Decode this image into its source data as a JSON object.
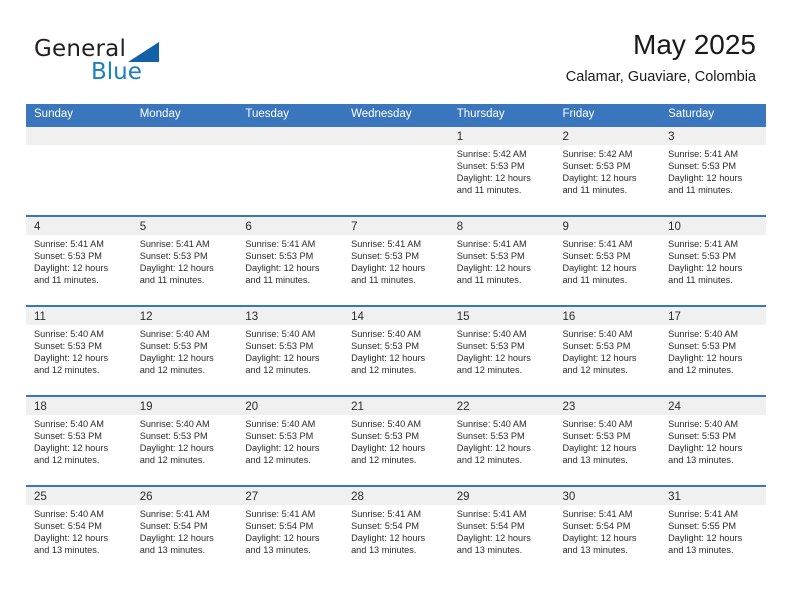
{
  "brand": {
    "name_part1": "General",
    "name_part2": "Blue",
    "triangle_color": "#1260a8",
    "blue_text_color": "#1a7fc1"
  },
  "header": {
    "title": "May 2025",
    "subtitle": "Calamar, Guaviare, Colombia"
  },
  "theme": {
    "header_bar_color": "#3a76bd",
    "day_band_color": "#f0f0f0",
    "text_color": "#2b2b2b"
  },
  "weekdays": [
    "Sunday",
    "Monday",
    "Tuesday",
    "Wednesday",
    "Thursday",
    "Friday",
    "Saturday"
  ],
  "weeks": [
    [
      {
        "day": "",
        "empty": true
      },
      {
        "day": "",
        "empty": true
      },
      {
        "day": "",
        "empty": true
      },
      {
        "day": "",
        "empty": true
      },
      {
        "day": "1",
        "sunrise": "Sunrise: 5:42 AM",
        "sunset": "Sunset: 5:53 PM",
        "daylight1": "Daylight: 12 hours",
        "daylight2": "and 11 minutes."
      },
      {
        "day": "2",
        "sunrise": "Sunrise: 5:42 AM",
        "sunset": "Sunset: 5:53 PM",
        "daylight1": "Daylight: 12 hours",
        "daylight2": "and 11 minutes."
      },
      {
        "day": "3",
        "sunrise": "Sunrise: 5:41 AM",
        "sunset": "Sunset: 5:53 PM",
        "daylight1": "Daylight: 12 hours",
        "daylight2": "and 11 minutes."
      }
    ],
    [
      {
        "day": "4",
        "sunrise": "Sunrise: 5:41 AM",
        "sunset": "Sunset: 5:53 PM",
        "daylight1": "Daylight: 12 hours",
        "daylight2": "and 11 minutes."
      },
      {
        "day": "5",
        "sunrise": "Sunrise: 5:41 AM",
        "sunset": "Sunset: 5:53 PM",
        "daylight1": "Daylight: 12 hours",
        "daylight2": "and 11 minutes."
      },
      {
        "day": "6",
        "sunrise": "Sunrise: 5:41 AM",
        "sunset": "Sunset: 5:53 PM",
        "daylight1": "Daylight: 12 hours",
        "daylight2": "and 11 minutes."
      },
      {
        "day": "7",
        "sunrise": "Sunrise: 5:41 AM",
        "sunset": "Sunset: 5:53 PM",
        "daylight1": "Daylight: 12 hours",
        "daylight2": "and 11 minutes."
      },
      {
        "day": "8",
        "sunrise": "Sunrise: 5:41 AM",
        "sunset": "Sunset: 5:53 PM",
        "daylight1": "Daylight: 12 hours",
        "daylight2": "and 11 minutes."
      },
      {
        "day": "9",
        "sunrise": "Sunrise: 5:41 AM",
        "sunset": "Sunset: 5:53 PM",
        "daylight1": "Daylight: 12 hours",
        "daylight2": "and 11 minutes."
      },
      {
        "day": "10",
        "sunrise": "Sunrise: 5:41 AM",
        "sunset": "Sunset: 5:53 PM",
        "daylight1": "Daylight: 12 hours",
        "daylight2": "and 11 minutes."
      }
    ],
    [
      {
        "day": "11",
        "sunrise": "Sunrise: 5:40 AM",
        "sunset": "Sunset: 5:53 PM",
        "daylight1": "Daylight: 12 hours",
        "daylight2": "and 12 minutes."
      },
      {
        "day": "12",
        "sunrise": "Sunrise: 5:40 AM",
        "sunset": "Sunset: 5:53 PM",
        "daylight1": "Daylight: 12 hours",
        "daylight2": "and 12 minutes."
      },
      {
        "day": "13",
        "sunrise": "Sunrise: 5:40 AM",
        "sunset": "Sunset: 5:53 PM",
        "daylight1": "Daylight: 12 hours",
        "daylight2": "and 12 minutes."
      },
      {
        "day": "14",
        "sunrise": "Sunrise: 5:40 AM",
        "sunset": "Sunset: 5:53 PM",
        "daylight1": "Daylight: 12 hours",
        "daylight2": "and 12 minutes."
      },
      {
        "day": "15",
        "sunrise": "Sunrise: 5:40 AM",
        "sunset": "Sunset: 5:53 PM",
        "daylight1": "Daylight: 12 hours",
        "daylight2": "and 12 minutes."
      },
      {
        "day": "16",
        "sunrise": "Sunrise: 5:40 AM",
        "sunset": "Sunset: 5:53 PM",
        "daylight1": "Daylight: 12 hours",
        "daylight2": "and 12 minutes."
      },
      {
        "day": "17",
        "sunrise": "Sunrise: 5:40 AM",
        "sunset": "Sunset: 5:53 PM",
        "daylight1": "Daylight: 12 hours",
        "daylight2": "and 12 minutes."
      }
    ],
    [
      {
        "day": "18",
        "sunrise": "Sunrise: 5:40 AM",
        "sunset": "Sunset: 5:53 PM",
        "daylight1": "Daylight: 12 hours",
        "daylight2": "and 12 minutes."
      },
      {
        "day": "19",
        "sunrise": "Sunrise: 5:40 AM",
        "sunset": "Sunset: 5:53 PM",
        "daylight1": "Daylight: 12 hours",
        "daylight2": "and 12 minutes."
      },
      {
        "day": "20",
        "sunrise": "Sunrise: 5:40 AM",
        "sunset": "Sunset: 5:53 PM",
        "daylight1": "Daylight: 12 hours",
        "daylight2": "and 12 minutes."
      },
      {
        "day": "21",
        "sunrise": "Sunrise: 5:40 AM",
        "sunset": "Sunset: 5:53 PM",
        "daylight1": "Daylight: 12 hours",
        "daylight2": "and 12 minutes."
      },
      {
        "day": "22",
        "sunrise": "Sunrise: 5:40 AM",
        "sunset": "Sunset: 5:53 PM",
        "daylight1": "Daylight: 12 hours",
        "daylight2": "and 12 minutes."
      },
      {
        "day": "23",
        "sunrise": "Sunrise: 5:40 AM",
        "sunset": "Sunset: 5:53 PM",
        "daylight1": "Daylight: 12 hours",
        "daylight2": "and 13 minutes."
      },
      {
        "day": "24",
        "sunrise": "Sunrise: 5:40 AM",
        "sunset": "Sunset: 5:53 PM",
        "daylight1": "Daylight: 12 hours",
        "daylight2": "and 13 minutes."
      }
    ],
    [
      {
        "day": "25",
        "sunrise": "Sunrise: 5:40 AM",
        "sunset": "Sunset: 5:54 PM",
        "daylight1": "Daylight: 12 hours",
        "daylight2": "and 13 minutes."
      },
      {
        "day": "26",
        "sunrise": "Sunrise: 5:41 AM",
        "sunset": "Sunset: 5:54 PM",
        "daylight1": "Daylight: 12 hours",
        "daylight2": "and 13 minutes."
      },
      {
        "day": "27",
        "sunrise": "Sunrise: 5:41 AM",
        "sunset": "Sunset: 5:54 PM",
        "daylight1": "Daylight: 12 hours",
        "daylight2": "and 13 minutes."
      },
      {
        "day": "28",
        "sunrise": "Sunrise: 5:41 AM",
        "sunset": "Sunset: 5:54 PM",
        "daylight1": "Daylight: 12 hours",
        "daylight2": "and 13 minutes."
      },
      {
        "day": "29",
        "sunrise": "Sunrise: 5:41 AM",
        "sunset": "Sunset: 5:54 PM",
        "daylight1": "Daylight: 12 hours",
        "daylight2": "and 13 minutes."
      },
      {
        "day": "30",
        "sunrise": "Sunrise: 5:41 AM",
        "sunset": "Sunset: 5:54 PM",
        "daylight1": "Daylight: 12 hours",
        "daylight2": "and 13 minutes."
      },
      {
        "day": "31",
        "sunrise": "Sunrise: 5:41 AM",
        "sunset": "Sunset: 5:55 PM",
        "daylight1": "Daylight: 12 hours",
        "daylight2": "and 13 minutes."
      }
    ]
  ]
}
